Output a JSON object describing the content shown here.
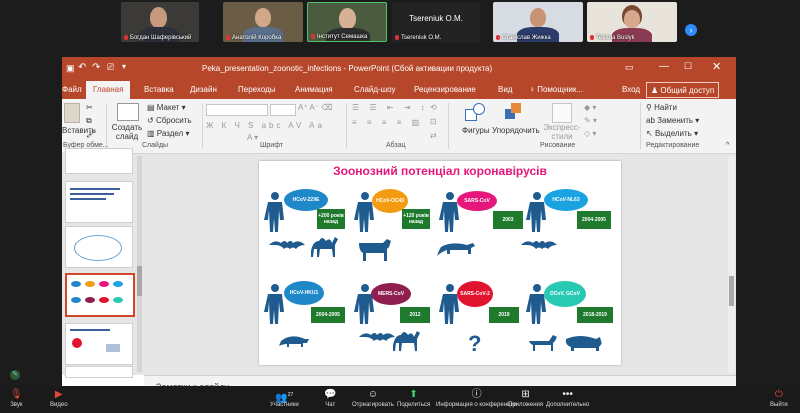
{
  "participants": [
    {
      "name": "Богдан Шаферівський"
    },
    {
      "name": "Анатолій Коробка"
    },
    {
      "name": "Інститут Семашка"
    },
    {
      "name": "Tsereniuk O.M.",
      "big_label": "Tsereniuk O.M."
    },
    {
      "name": "Станіслав Жижка"
    },
    {
      "name": "Tetiana Buslyk"
    }
  ],
  "ppt": {
    "window_title": "Peka_presentation_zoonotic_infections  -  PowerPoint (Сбой активации продукта)",
    "tabs": [
      "Файл",
      "Главная",
      "Вставка",
      "Дизайн",
      "Переходы",
      "Анимация",
      "Слайд-шоу",
      "Рецензирование",
      "Вид",
      "Помощник..."
    ],
    "signin": "Вход",
    "share": "Общий доступ",
    "ribbon": {
      "paste": "Вставить",
      "layout": "Макет",
      "reset": "Сбросить",
      "section": "Раздел",
      "new_slide": "Создать слайд",
      "shapes": "Фигуры",
      "arrange": "Упорядочить",
      "express": "Экспресс-стили",
      "find": "Найти",
      "replace": "Заменить",
      "select": "Выделить",
      "groups": {
        "clipboard": "Буфер обме...",
        "slides": "Слайды",
        "font": "Шрифт",
        "paragraph": "Абзац",
        "drawing": "Рисование",
        "editing": "Редактирование"
      }
    },
    "notes_placeholder": "Заметки к слайду"
  },
  "slide": {
    "title": "Зоонозний потенціал коронавірусів",
    "row1": [
      {
        "virus": "HCoV-229E",
        "color": "#1e88c9",
        "label": "+200 років назад"
      },
      {
        "virus": "HCoV-OC43",
        "color": "#f39c12",
        "label": "+120 років назад"
      },
      {
        "virus": "SARS-CoV",
        "color": "#e5177b",
        "label": "2003"
      },
      {
        "virus": "HCoV-NL63",
        "color": "#1aa3e0",
        "label": "2004-2005"
      }
    ],
    "row2": [
      {
        "virus": "HCoV-HKU1",
        "color": "#1e88c9",
        "label": "2004-2005"
      },
      {
        "virus": "MERS-CoV",
        "color": "#8e1f4f",
        "label": "2012"
      },
      {
        "virus": "SARS-CoV-2",
        "color": "#e0142f",
        "label": "2019",
        "mystery": "?"
      },
      {
        "virus": "DCoV, GCoV",
        "color": "#27c9b2",
        "label": "2018-2019"
      }
    ]
  },
  "toolbar": [
    {
      "label": "Звук",
      "icon": "mic-icon"
    },
    {
      "label": "Видео",
      "icon": "video-icon"
    },
    {
      "label": "Участники",
      "icon": "participants-icon",
      "count": "27"
    },
    {
      "label": "Чат",
      "icon": "chat-icon"
    },
    {
      "label": "Отреагировать",
      "icon": "react-icon"
    },
    {
      "label": "Поделиться",
      "icon": "share-icon"
    },
    {
      "label": "Информация о конференции",
      "icon": "info-icon"
    },
    {
      "label": "Приложения",
      "icon": "apps-icon"
    },
    {
      "label": "Дополнительно",
      "icon": "more-icon"
    },
    {
      "label": "Выйти",
      "icon": "leave-icon"
    }
  ]
}
